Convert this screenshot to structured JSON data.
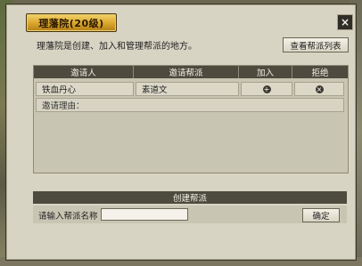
{
  "window": {
    "title": "理藩院(20级)",
    "close_label": "×"
  },
  "intro": {
    "description": "理藩院是创建、加入和管理帮派的地方。",
    "view_list_button": "查看帮派列表"
  },
  "invite_table": {
    "columns": [
      "邀请人",
      "邀请帮派",
      "加入",
      "拒绝"
    ],
    "rows": [
      {
        "inviter": "铁血丹心",
        "faction": "素道文",
        "join_icon": "plus-circle-icon",
        "reject_icon": "x-circle-icon"
      }
    ],
    "reason_label": "邀请理由："
  },
  "create_faction": {
    "header": "创建帮派",
    "name_label": "请输入帮派名称",
    "name_value": "",
    "confirm_button": "确定"
  },
  "colors": {
    "panel_bg": "#d8d4c4",
    "header_bg": "#4d4a3e",
    "title_gold": "#d9a52c"
  }
}
